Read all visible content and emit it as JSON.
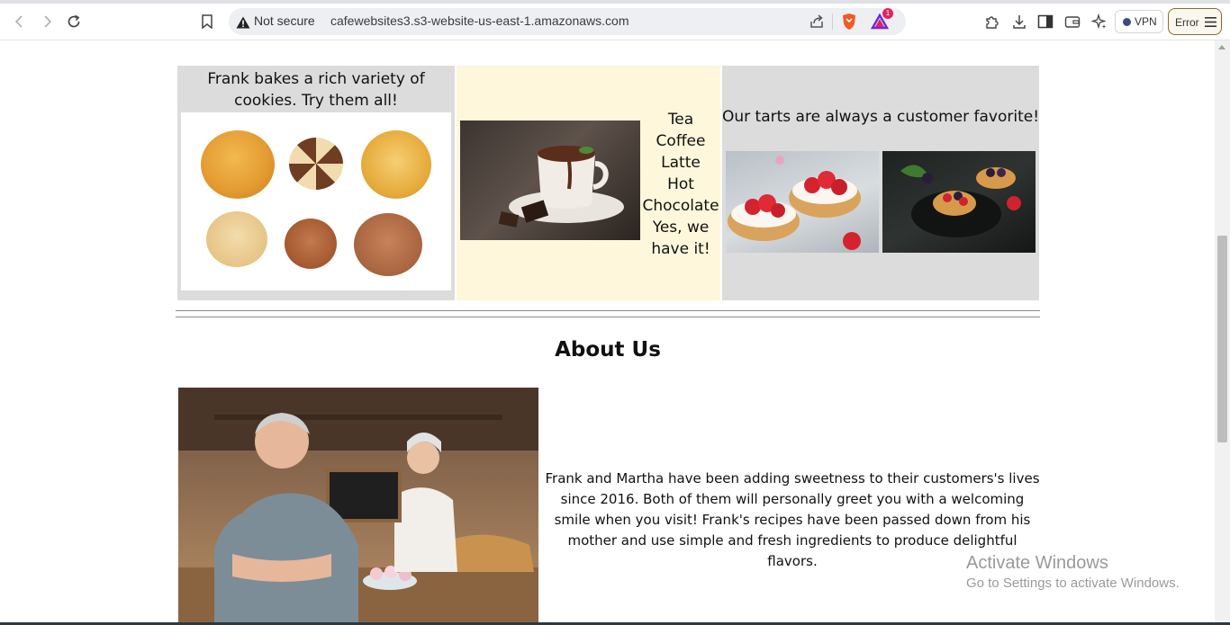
{
  "browser": {
    "security_label": "Not secure",
    "url": "cafewebsites3.s3-website-us-east-1.amazonaws.com",
    "vpn_label": "VPN",
    "error_label": "Error",
    "brave_rewards_count": "1",
    "icons": [
      "back-icon",
      "forward-icon",
      "reload-icon",
      "bookmark-icon",
      "warning-icon",
      "share-icon",
      "brave-shields-icon",
      "brave-rewards-icon",
      "extensions-icon",
      "download-icon",
      "sidebar-icon",
      "wallet-icon",
      "leo-ai-icon",
      "menu-icon"
    ]
  },
  "products": {
    "cookies_caption": "Frank bakes a rich variety of cookies. Try them all!",
    "drinks": [
      "Tea",
      "Coffee",
      "Latte",
      "Hot Chocolate",
      "Yes, we have it!"
    ],
    "tarts_caption": "Our tarts are always a customer favorite!"
  },
  "about": {
    "title": "About Us",
    "text": "Frank and Martha have been adding sweetness to their customers's lives since 2016. Both of them will personally greet you with a welcoming smile when you visit! Frank's recipes have been passed down from his mother and use simple and fresh ingredients to produce delightful flavors."
  },
  "watermark": {
    "line1": "Activate Windows",
    "line2": "Go to Settings to activate Windows."
  },
  "colors": {
    "panel_gray": "#dcdcdc",
    "panel_cream": "#fff7dc",
    "error_border": "#8a6a2a"
  }
}
